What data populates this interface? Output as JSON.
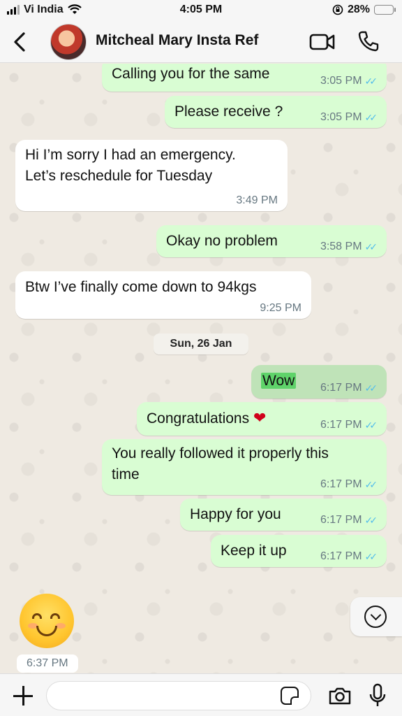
{
  "status_bar": {
    "carrier": "Vi India",
    "time": "4:05 PM",
    "battery_percent": "28%",
    "battery_level": 0.28
  },
  "header": {
    "contact_name": "Mitcheal Mary Insta Ref"
  },
  "messages": [
    {
      "direction": "out",
      "text": "Calling you for the same",
      "time": "3:05 PM"
    },
    {
      "direction": "out",
      "text": "Please receive ?",
      "time": "3:05 PM"
    },
    {
      "direction": "in",
      "text_line1": "Hi I’m sorry I had an emergency.",
      "text_line2": "Let’s reschedule for Tuesday",
      "time": "3:49 PM"
    },
    {
      "direction": "out",
      "text": "Okay no problem",
      "time": "3:58 PM"
    },
    {
      "direction": "in",
      "text": "Btw I’ve finally come down to 94kgs",
      "time": "9:25 PM"
    },
    {
      "direction": "out",
      "text": "Wow",
      "time": "6:17 PM"
    },
    {
      "direction": "out",
      "text": "Congratulations",
      "time": "6:17 PM"
    },
    {
      "direction": "out",
      "text_line1": "You really followed it properly this",
      "text_line2": "time",
      "time": "6:17 PM"
    },
    {
      "direction": "out",
      "text": "Happy for you",
      "time": "6:17 PM"
    },
    {
      "direction": "out",
      "text": "Keep it up",
      "time": "6:17 PM"
    },
    {
      "direction": "in",
      "emoji": "smiling-face-with-smiling-eyes",
      "time": "6:37 PM"
    }
  ],
  "date_divider": "Sun, 26 Jan",
  "input": {
    "placeholder": ""
  },
  "colors": {
    "outgoing_bubble": "#d9fdd3",
    "incoming_bubble": "#ffffff",
    "read_ticks": "#53bdeb",
    "chat_background": "#efeae2"
  }
}
